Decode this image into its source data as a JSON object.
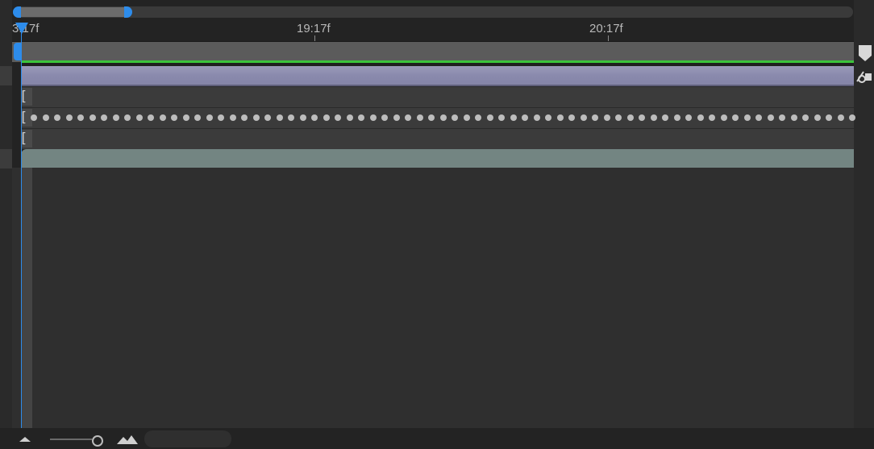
{
  "ruler": {
    "labels": [
      "3:17f",
      "19:17f",
      "20:17f"
    ]
  },
  "timeline": {
    "playhead_time": "3:17f",
    "keyframe_count": 71
  },
  "icons": {
    "marker": "marker-icon",
    "snap": "snap-icon",
    "zoom_out": "zoom-out-icon",
    "zoom_in": "zoom-in-icon"
  },
  "colors": {
    "accent": "#2d8ceb",
    "work_area_green": "#3bc43b",
    "layer_bar": "#8a8aad",
    "teal_bar": "#738582"
  }
}
